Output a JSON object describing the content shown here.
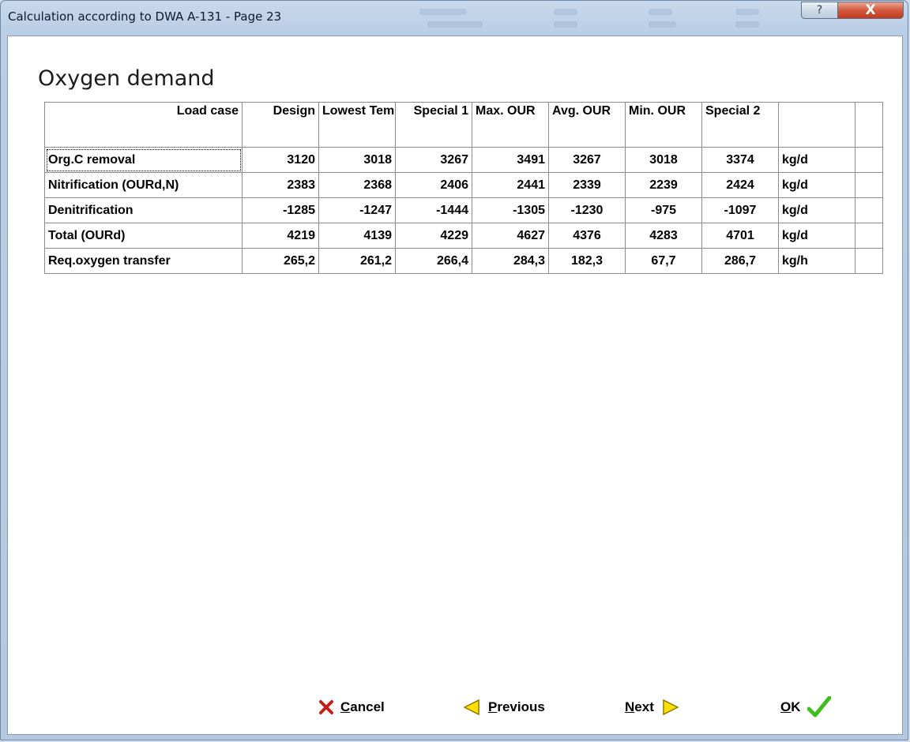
{
  "window": {
    "title": "Calculation according to DWA  A-131 - Page 23",
    "help_glyph": "?",
    "close_glyph": "X"
  },
  "page": {
    "heading": "Oxygen demand"
  },
  "table": {
    "corner_label": "Load case",
    "columns": [
      {
        "label": "Design",
        "align": "r"
      },
      {
        "label": "Lowest\nTemp.",
        "align": "l"
      },
      {
        "label": "Special\n1",
        "align": "r"
      },
      {
        "label": "Max.\nOUR",
        "align": "l"
      },
      {
        "label": "Avg.\nOUR",
        "align": "l"
      },
      {
        "label": "Min.\nOUR",
        "align": "l"
      },
      {
        "label": "Special\n2",
        "align": "l"
      }
    ],
    "rows": [
      {
        "label": "Org.C removal",
        "values": [
          "3120",
          "3018",
          "3267",
          "3491",
          "3267",
          "3018",
          "3374"
        ],
        "unit": "kg/d"
      },
      {
        "label": "Nitrification (OURd,N)",
        "values": [
          "2383",
          "2368",
          "2406",
          "2441",
          "2339",
          "2239",
          "2424"
        ],
        "unit": "kg/d"
      },
      {
        "label": "Denitrification",
        "values": [
          "-1285",
          "-1247",
          "-1444",
          "-1305",
          "-1230",
          "-975",
          "-1097"
        ],
        "unit": "kg/d"
      },
      {
        "label": "Total (OURd)",
        "values": [
          "4219",
          "4139",
          "4229",
          "4627",
          "4376",
          "4283",
          "4701"
        ],
        "unit": "kg/d"
      },
      {
        "label": "Req.oxygen transfer",
        "values": [
          "265,2",
          "261,2",
          "266,4",
          "284,3",
          "182,3",
          "67,7",
          "286,7"
        ],
        "unit": "kg/h"
      }
    ]
  },
  "buttons": {
    "cancel": {
      "mnemonic": "C",
      "rest": "ancel",
      "icon": "red-x-icon"
    },
    "previous": {
      "mnemonic": "P",
      "rest": "revious",
      "icon": "left-arrow-icon"
    },
    "next": {
      "mnemonic": "N",
      "rest": "ext",
      "icon": "right-arrow-icon"
    },
    "ok": {
      "mnemonic": "O",
      "rest": "K",
      "icon": "green-check-icon"
    }
  },
  "colors": {
    "cancel_icon": "#c0201a",
    "arrow_fill": "#ffe000",
    "check": "#3fbf1f"
  }
}
